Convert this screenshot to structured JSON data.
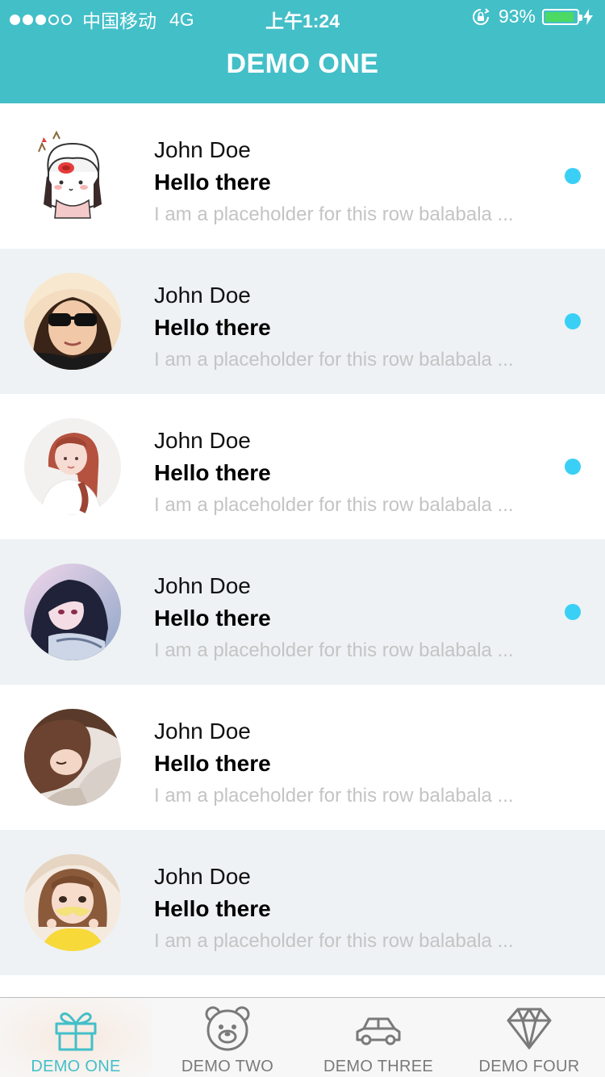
{
  "status_bar": {
    "carrier": "中国移动",
    "network": "4G",
    "time": "上午1:24",
    "battery": "93%",
    "battery_level": 0.93
  },
  "nav": {
    "title": "DEMO ONE"
  },
  "list": {
    "rows": [
      {
        "name": "John Doe",
        "title": "Hello there",
        "description": "I am a placeholder for this row balabala ...",
        "unread": true
      },
      {
        "name": "John Doe",
        "title": "Hello there",
        "description": "I am a placeholder for this row balabala ...",
        "unread": true
      },
      {
        "name": "John Doe",
        "title": "Hello there",
        "description": "I am a placeholder for this row balabala ...",
        "unread": true
      },
      {
        "name": "John Doe",
        "title": "Hello there",
        "description": "I am a placeholder for this row balabala ...",
        "unread": true
      },
      {
        "name": "John Doe",
        "title": "Hello there",
        "description": "I am a placeholder for this row balabala ...",
        "unread": false
      },
      {
        "name": "John Doe",
        "title": "Hello there",
        "description": "I am a placeholder for this row balabala ...",
        "unread": false
      }
    ]
  },
  "tabs": [
    {
      "label": "DEMO ONE",
      "icon": "gift-icon",
      "active": true
    },
    {
      "label": "DEMO TWO",
      "icon": "bear-icon",
      "active": false
    },
    {
      "label": "DEMO THREE",
      "icon": "car-icon",
      "active": false
    },
    {
      "label": "DEMO FOUR",
      "icon": "diamond-icon",
      "active": false
    }
  ],
  "colors": {
    "accent": "#43bfc8",
    "unread_dot": "#3ad0f5",
    "battery_fill": "#4cd964"
  }
}
